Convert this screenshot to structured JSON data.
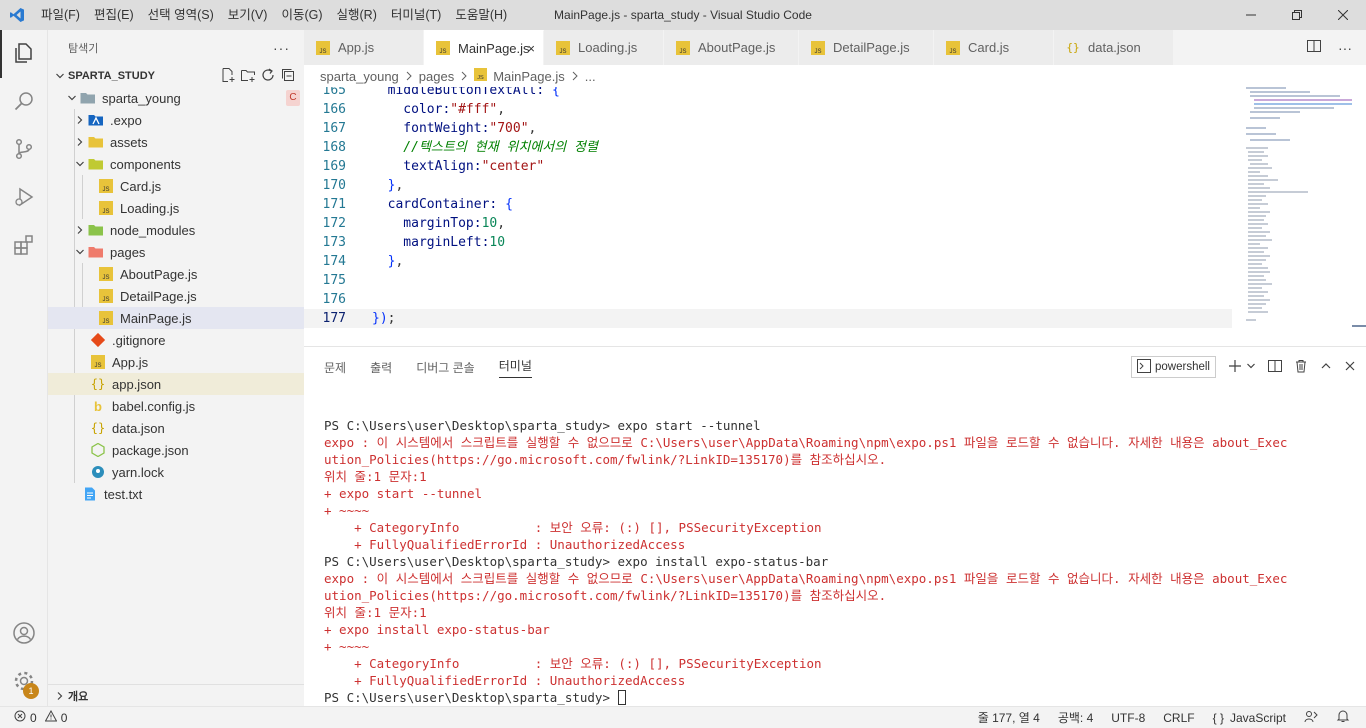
{
  "window": {
    "title": "MainPage.js - sparta_study - Visual Studio Code",
    "menu": [
      "파일(F)",
      "편집(E)",
      "선택 영역(S)",
      "보기(V)",
      "이동(G)",
      "실행(R)",
      "터미널(T)",
      "도움말(H)"
    ]
  },
  "activity": {
    "icons": [
      "files-icon",
      "search-icon",
      "source-control-icon",
      "run-debug-icon",
      "extensions-icon"
    ],
    "settings_badge": "1"
  },
  "sidebar": {
    "header": "탐색기",
    "section": "SPARTA_STUDY",
    "outline": "개요",
    "tree": [
      {
        "label": "sparta_young",
        "mark": "C"
      },
      {
        "label": ".expo"
      },
      {
        "label": "assets"
      },
      {
        "label": "components"
      },
      {
        "label": "Card.js"
      },
      {
        "label": "Loading.js"
      },
      {
        "label": "node_modules"
      },
      {
        "label": "pages"
      },
      {
        "label": "AboutPage.js"
      },
      {
        "label": "DetailPage.js"
      },
      {
        "label": "MainPage.js"
      },
      {
        "label": ".gitignore"
      },
      {
        "label": "App.js"
      },
      {
        "label": "app.json"
      },
      {
        "label": "babel.config.js"
      },
      {
        "label": "data.json"
      },
      {
        "label": "package.json"
      },
      {
        "label": "yarn.lock"
      },
      {
        "label": "test.txt"
      }
    ]
  },
  "tabs": [
    {
      "label": "App.js"
    },
    {
      "label": "MainPage.js",
      "close": "×"
    },
    {
      "label": "Loading.js"
    },
    {
      "label": "AboutPage.js"
    },
    {
      "label": "DetailPage.js"
    },
    {
      "label": "Card.js"
    },
    {
      "label": "data.json"
    }
  ],
  "breadcrumb": [
    "sparta_young",
    "pages",
    "MainPage.js",
    "..."
  ],
  "editor": {
    "lines": [
      {
        "n": "165",
        "text": "  middleButtonTextAll: {"
      },
      {
        "n": "166",
        "text": "    color:\"#fff\","
      },
      {
        "n": "167",
        "text": "    fontWeight:\"700\","
      },
      {
        "n": "168",
        "text": "    //텍스트의 현재 위치에서의 정렬"
      },
      {
        "n": "169",
        "text": "    textAlign:\"center\""
      },
      {
        "n": "170",
        "text": "  },"
      },
      {
        "n": "171",
        "text": "  cardContainer: {"
      },
      {
        "n": "172",
        "text": "    marginTop:10,"
      },
      {
        "n": "173",
        "text": "    marginLeft:10"
      },
      {
        "n": "174",
        "text": "  },"
      },
      {
        "n": "175",
        "text": ""
      },
      {
        "n": "176",
        "text": ""
      },
      {
        "n": "177",
        "text": "});"
      }
    ]
  },
  "panel": {
    "tabs": [
      "문제",
      "출력",
      "디버그 콘솔",
      "터미널"
    ],
    "shell": "powershell",
    "terminal": [
      {
        "t": "PS C:\\Users\\user\\Desktop\\sparta_study> expo start --tunnel",
        "err": false
      },
      {
        "t": "expo : 이 시스템에서 스크립트를 실행할 수 없으므로 C:\\Users\\user\\AppData\\Roaming\\npm\\expo.ps1 파일을 로드할 수 없습니다. 자세한 내용은 about_Exec",
        "err": true
      },
      {
        "t": "ution_Policies(https://go.microsoft.com/fwlink/?LinkID=135170)를 참조하십시오.",
        "err": true
      },
      {
        "t": "위치 줄:1 문자:1",
        "err": true
      },
      {
        "t": "+ expo start --tunnel",
        "err": true
      },
      {
        "t": "+ ~~~~",
        "err": true
      },
      {
        "t": "    + CategoryInfo          : 보안 오류: (:) [], PSSecurityException",
        "err": true
      },
      {
        "t": "    + FullyQualifiedErrorId : UnauthorizedAccess",
        "err": true
      },
      {
        "t": "PS C:\\Users\\user\\Desktop\\sparta_study> expo install expo-status-bar",
        "err": false
      },
      {
        "t": "expo : 이 시스템에서 스크립트를 실행할 수 없으므로 C:\\Users\\user\\AppData\\Roaming\\npm\\expo.ps1 파일을 로드할 수 없습니다. 자세한 내용은 about_Exec",
        "err": true
      },
      {
        "t": "ution_Policies(https://go.microsoft.com/fwlink/?LinkID=135170)를 참조하십시오.",
        "err": true
      },
      {
        "t": "위치 줄:1 문자:1",
        "err": true
      },
      {
        "t": "+ expo install expo-status-bar",
        "err": true
      },
      {
        "t": "+ ~~~~",
        "err": true
      },
      {
        "t": "    + CategoryInfo          : 보안 오류: (:) [], PSSecurityException",
        "err": true
      },
      {
        "t": "    + FullyQualifiedErrorId : UnauthorizedAccess",
        "err": true
      }
    ],
    "prompt": "PS C:\\Users\\user\\Desktop\\sparta_study> "
  },
  "status": {
    "errors": "0",
    "warnings": "0",
    "position": "줄 177, 열 4",
    "spaces": "공백: 4",
    "encoding": "UTF-8",
    "eol": "CRLF",
    "language": "JavaScript",
    "language_icon": "{ }"
  },
  "colors": {
    "js_icon": "#e8c33a",
    "folder": "#90a4ae",
    "error_text": "#cd3131",
    "vscode_blue": "#2a7ad1"
  }
}
